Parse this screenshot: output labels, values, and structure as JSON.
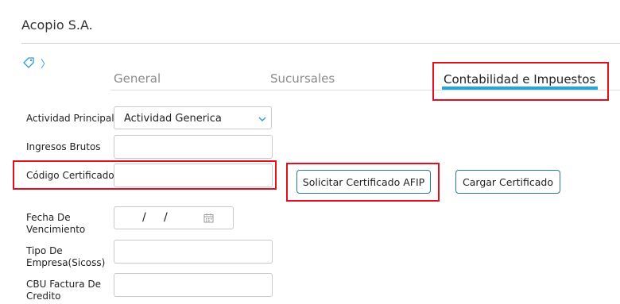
{
  "header": {
    "company": "Acopio S.A."
  },
  "breadcrumb": {
    "chevron": "〉"
  },
  "tabs": [
    {
      "label": "General"
    },
    {
      "label": "Sucursales"
    },
    {
      "label": "Contabilidad e Impuestos"
    }
  ],
  "form": {
    "actividad_label": "Actividad Principal",
    "actividad_value": "Actividad Generica",
    "ingresos_label": "Ingresos Brutos",
    "codigo_label": "Código Certificado",
    "fecha_label": "Fecha De Vencimiento",
    "fecha_sep1": "/",
    "fecha_sep2": "/",
    "tipo_label": "Tipo De Empresa(Sicoss)",
    "cbu_label": "CBU Factura De Credito"
  },
  "buttons": {
    "solicitar": "Solicitar Certificado AFIP",
    "cargar": "Cargar Certificado"
  },
  "colors": {
    "accent": "#22a7d6",
    "highlight": "#e01020",
    "button_border": "#2b7a92"
  }
}
